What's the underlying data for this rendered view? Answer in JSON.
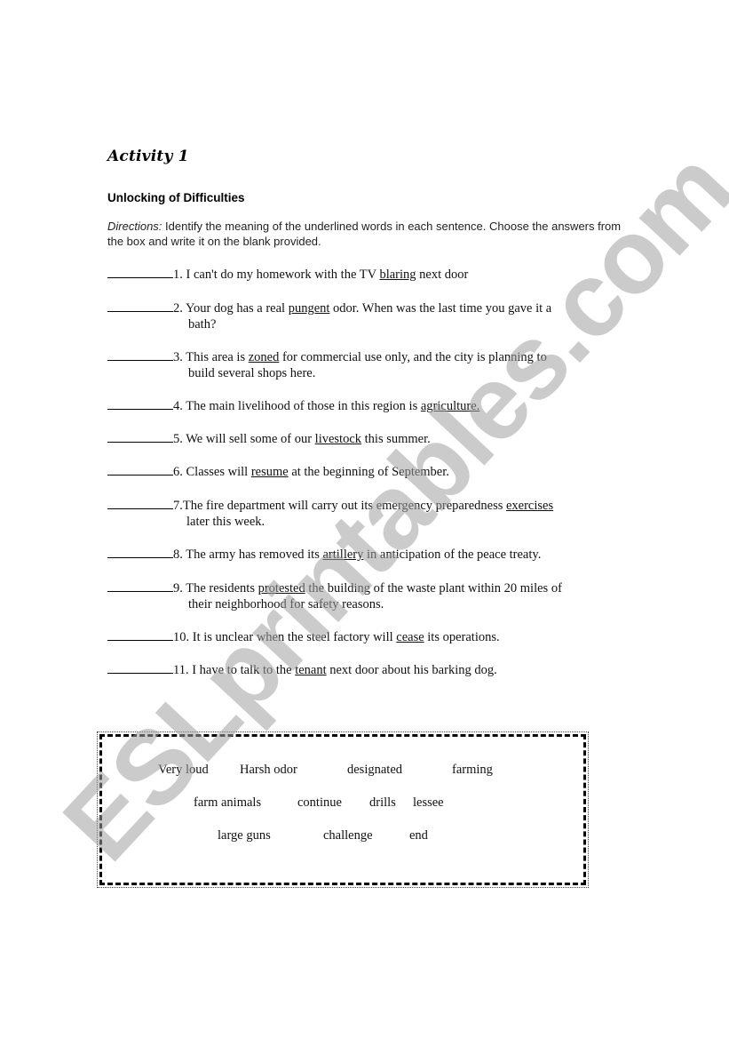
{
  "document": {
    "activity_title": "Activity 1",
    "section_title": "Unlocking of Difficulties",
    "directions_label": "Directions:",
    "directions_text": " Identify the meaning of the underlined words in each sentence. Choose the answers from the box and write it on the blank provided."
  },
  "items": [
    {
      "num": "1. ",
      "before": "I can't do my homework with the TV ",
      "word": "blaring",
      "after": " next door",
      "cont": ""
    },
    {
      "num": "2.  ",
      "before": "Your dog has a real ",
      "word": "pungent",
      "after": " odor. When was the last time you gave it a",
      "cont": "bath?"
    },
    {
      "num": "3. ",
      "before": "This area is ",
      "word": "zoned",
      "after": " for commercial use only, and the city is planning to",
      "cont": "build several shops here."
    },
    {
      "num": "4. ",
      "before": "The main livelihood of those in this region is ",
      "word": "agriculture.",
      "after": "",
      "cont": ""
    },
    {
      "num": "5. ",
      "before": "We will sell some of our ",
      "word": "livestock",
      "after": " this summer.",
      "cont": ""
    },
    {
      "num": "6. ",
      "before": "Classes will ",
      "word": "resume",
      "after": " at the beginning of September.",
      "cont": ""
    },
    {
      "num": "7.",
      "before": "The fire department will carry out its emergency preparedness ",
      "word": "exercises",
      "after": "",
      "cont": "later this week."
    },
    {
      "num": "8.  ",
      "before": "The army has removed its ",
      "word": "artillery",
      "after": " in anticipation of the peace treaty.",
      "cont": ""
    },
    {
      "num": "9.  ",
      "before": "The residents ",
      "word": "protested",
      "after": " the building of the waste plant within 20 miles of",
      "cont": "their neighborhood for safety reasons."
    },
    {
      "num": "10. ",
      "before": "It is unclear when the steel factory will ",
      "word": "cease",
      "after": " its operations.",
      "cont": ""
    },
    {
      "num": "11. ",
      "before": "I have to talk to the ",
      "word": "tenant",
      "after": " next door about his barking dog.",
      "cont": ""
    }
  ],
  "word_box": {
    "words": [
      "Very loud",
      "Harsh odor",
      "designated",
      "farming",
      "farm animals",
      "continue",
      "drills",
      "lessee",
      "large guns",
      "challenge",
      "end"
    ]
  },
  "watermark": {
    "text": "ESLprintables.com",
    "color": "#a0a0a0"
  }
}
